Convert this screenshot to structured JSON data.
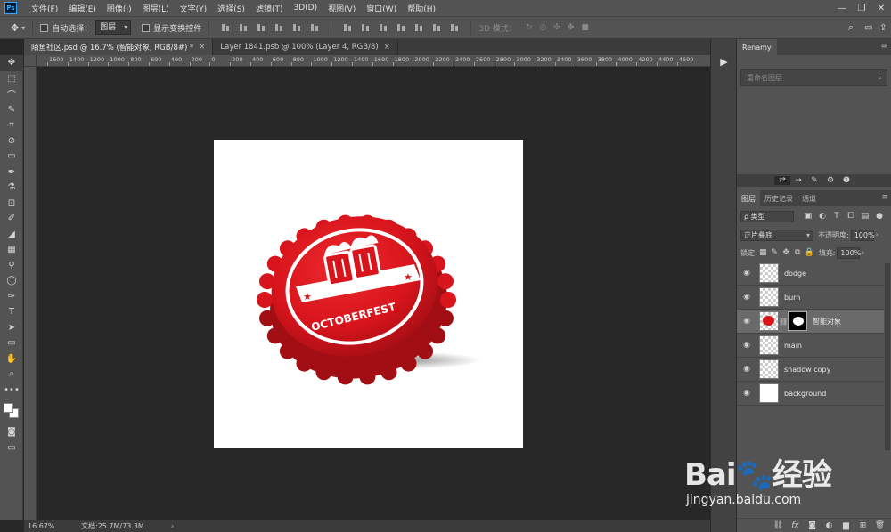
{
  "menubar": {
    "logo": "Ps",
    "items": [
      "文件(F)",
      "编辑(E)",
      "图像(I)",
      "图层(L)",
      "文字(Y)",
      "选择(S)",
      "滤镜(T)",
      "3D(D)",
      "视图(V)",
      "窗口(W)",
      "帮助(H)"
    ],
    "window_controls": [
      "—",
      "❐",
      "✕"
    ]
  },
  "options": {
    "auto_select_label": "自动选择：",
    "auto_select_value": "图层",
    "show_transform_label": "显示变换控件",
    "mode_3d_label": "3D 模式：",
    "right_icons": [
      "⌕",
      "▭",
      "⇪"
    ]
  },
  "doc_tabs": [
    {
      "label": "陌鱼社区.psd @ 16.7% (智能对象, RGB/8#) *",
      "close": "×"
    },
    {
      "label": "Layer 1841.psb @ 100% (Layer 4, RGB/8)",
      "close": "×"
    }
  ],
  "ruler": {
    "ticks": [
      "1600",
      "1400",
      "1200",
      "1000",
      "800",
      "600",
      "400",
      "200",
      "0",
      "200",
      "400",
      "600",
      "800",
      "1000",
      "1200",
      "1400",
      "1600",
      "1800",
      "2000",
      "2200",
      "2400",
      "2600",
      "2800",
      "3000",
      "3200",
      "3400",
      "3600",
      "3800",
      "4000",
      "4200",
      "4400",
      "4600"
    ]
  },
  "artwork": {
    "brand_text": "OCTOBERFEST",
    "colors": {
      "cap_red": "#d8141c",
      "cap_dark": "#a10e14",
      "cap_light": "#ee2a2f",
      "white": "#ffffff"
    }
  },
  "status": {
    "zoom": "16.67%",
    "doc_size": "文档:25.7M/73.3M",
    "arrow": "›"
  },
  "tools": [
    "✥",
    "⬚",
    "⌒",
    "✎",
    "⌗",
    "⊘",
    "▭",
    "✒",
    "⚗",
    "⊡",
    "✐",
    "◢",
    "▦",
    "⚲",
    "◯",
    "✑",
    "T",
    "➤",
    "▭",
    "✋",
    "⌕",
    "•••"
  ],
  "panels": {
    "renamy": {
      "tab": "Renamy",
      "search_placeholder": "重命名图层"
    },
    "layers": {
      "tabs": [
        "图层",
        "历史记录",
        "通道"
      ],
      "filter_label": "ρ 类型",
      "blend_mode": "正片叠底",
      "opacity_label": "不透明度:",
      "opacity_value": "100%",
      "lock_label": "锁定:",
      "fill_label": "填充:",
      "fill_value": "100%",
      "items": [
        {
          "name": "dodge"
        },
        {
          "name": "burn"
        },
        {
          "name": "智能对象"
        },
        {
          "name": "main"
        },
        {
          "name": "shadow copy"
        },
        {
          "name": "background"
        }
      ],
      "footer_icons": [
        "⛓",
        "fx",
        "◙",
        "◐",
        "▆",
        "⊞",
        "🗑"
      ]
    }
  },
  "watermark": {
    "brand": "Bai🐾经验",
    "url": "jingyan.baidu.com"
  }
}
